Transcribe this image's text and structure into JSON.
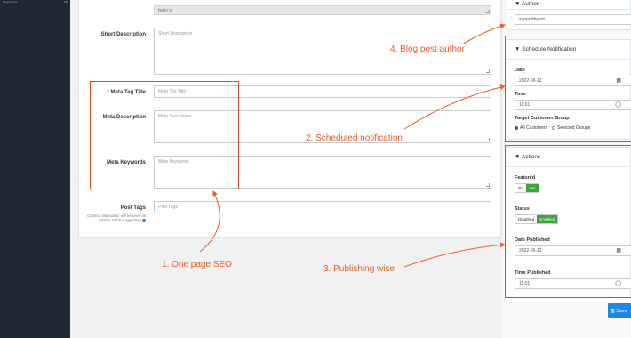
{
  "sidebar": {
    "item_label": "Blog Articles",
    "item_count": "0/0"
  },
  "editor": {
    "path": "body  p"
  },
  "fields": {
    "short_description": {
      "label": "Short Description",
      "placeholder": "Short Description"
    },
    "meta_title": {
      "required": "*",
      "label": "Meta Tag Title",
      "placeholder": "Meta Tag Title"
    },
    "meta_description": {
      "label": "Meta Description",
      "placeholder": "Meta Description"
    },
    "meta_keywords": {
      "label": "Meta Keywords",
      "placeholder": "Meta Keywords"
    },
    "post_tags": {
      "label": "Post Tags",
      "placeholder": "Post Tags",
      "help": "Comma separated, will be used as related article suggestion"
    }
  },
  "author": {
    "title": "Author",
    "value": "supporthpwd"
  },
  "schedule": {
    "title": "Schedule Notification",
    "date_label": "Date",
    "date_value": "2022-06-12",
    "time_label": "Time",
    "time_value": "11:01",
    "group_label": "Target Customer Group",
    "options": [
      "All Customers",
      "Selected Groups"
    ]
  },
  "actions": {
    "title": "Actions",
    "featured_label": "Featured",
    "featured_no": "No",
    "featured_yes": "Yes",
    "status_label": "Status",
    "status_disabled": "Disabled",
    "status_enabled": "Enabled",
    "date_published_label": "Date Published",
    "date_published_value": "2022-06-12",
    "time_published_label": "Time Published",
    "time_published_value": "11:01",
    "save_label": "Save"
  },
  "annotations": {
    "a1": "1. One page SEO",
    "a2": "2. Scheduled notification",
    "a3": "3. Publishing wise",
    "a4": "4. Blog post author"
  },
  "colors": {
    "annotation": "#f05a28",
    "sidebar": "#1f2934",
    "save": "#1e88e5",
    "toggle_on": "#3aa339"
  }
}
